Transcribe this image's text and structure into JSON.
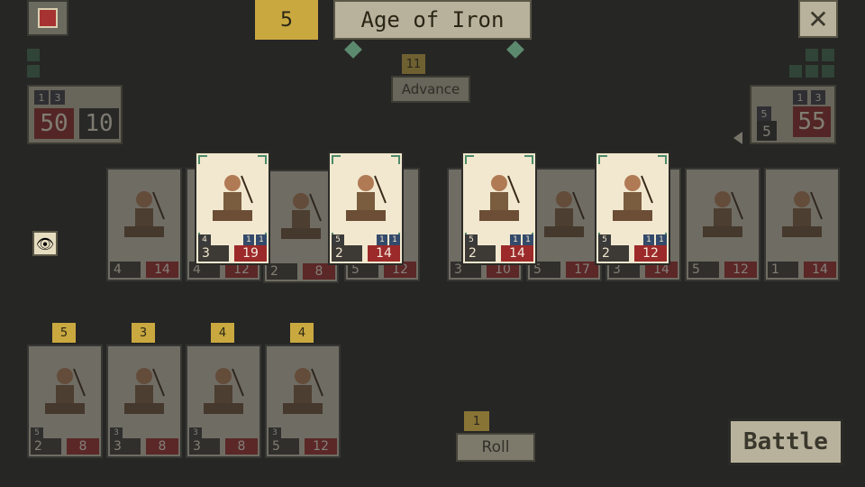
{
  "top": {
    "turn": "5",
    "title": "Age of Iron",
    "close_label": "✕",
    "advance_cost": "11",
    "advance_label": "Advance"
  },
  "player_left": {
    "mini_a": "1",
    "mini_b": "3",
    "life": "50",
    "gold": "10"
  },
  "player_right": {
    "mini_a": "1",
    "mini_b": "3",
    "mini_c": "5",
    "gold": "5",
    "life": "55"
  },
  "board_cards": [
    {
      "icon": "elephant-archer-icon",
      "lv": "4",
      "r1": "1",
      "r2": "1",
      "atk": "3",
      "hp": "19",
      "highlight": true
    },
    {
      "icon": "chariot-archer-icon",
      "lv": "5",
      "r1": "1",
      "r2": "1",
      "atk": "2",
      "hp": "14",
      "highlight": true
    },
    {
      "icon": "chariot-archer-icon",
      "lv": "5",
      "r1": "1",
      "r2": "1",
      "atk": "2",
      "hp": "14",
      "highlight": true
    },
    {
      "icon": "horse-archer-icon",
      "lv": "5",
      "r1": "1",
      "r2": "1",
      "atk": "2",
      "hp": "12",
      "highlight": true
    }
  ],
  "bg_cards": [
    {
      "atk": "4",
      "hp": "14"
    },
    {
      "atk": "4",
      "hp": "12"
    },
    {
      "atk": "2",
      "hp": "8"
    },
    {
      "atk": "5",
      "hp": "12"
    },
    {
      "atk": "3",
      "hp": "10"
    },
    {
      "atk": "5",
      "hp": "17"
    },
    {
      "atk": "3",
      "hp": "14"
    },
    {
      "atk": "5",
      "hp": "12"
    },
    {
      "atk": "1",
      "hp": "14"
    }
  ],
  "hand": [
    {
      "cost": "5",
      "lv": "5",
      "atk": "2",
      "hp": "8"
    },
    {
      "cost": "3",
      "lv": "3",
      "atk": "3",
      "hp": "8"
    },
    {
      "cost": "4",
      "lv": "3",
      "atk": "3",
      "hp": "8"
    },
    {
      "cost": "4",
      "lv": "3",
      "atk": "5",
      "hp": "12"
    }
  ],
  "roll_cost": "1",
  "roll_label": "Roll",
  "battle_label": "Battle"
}
